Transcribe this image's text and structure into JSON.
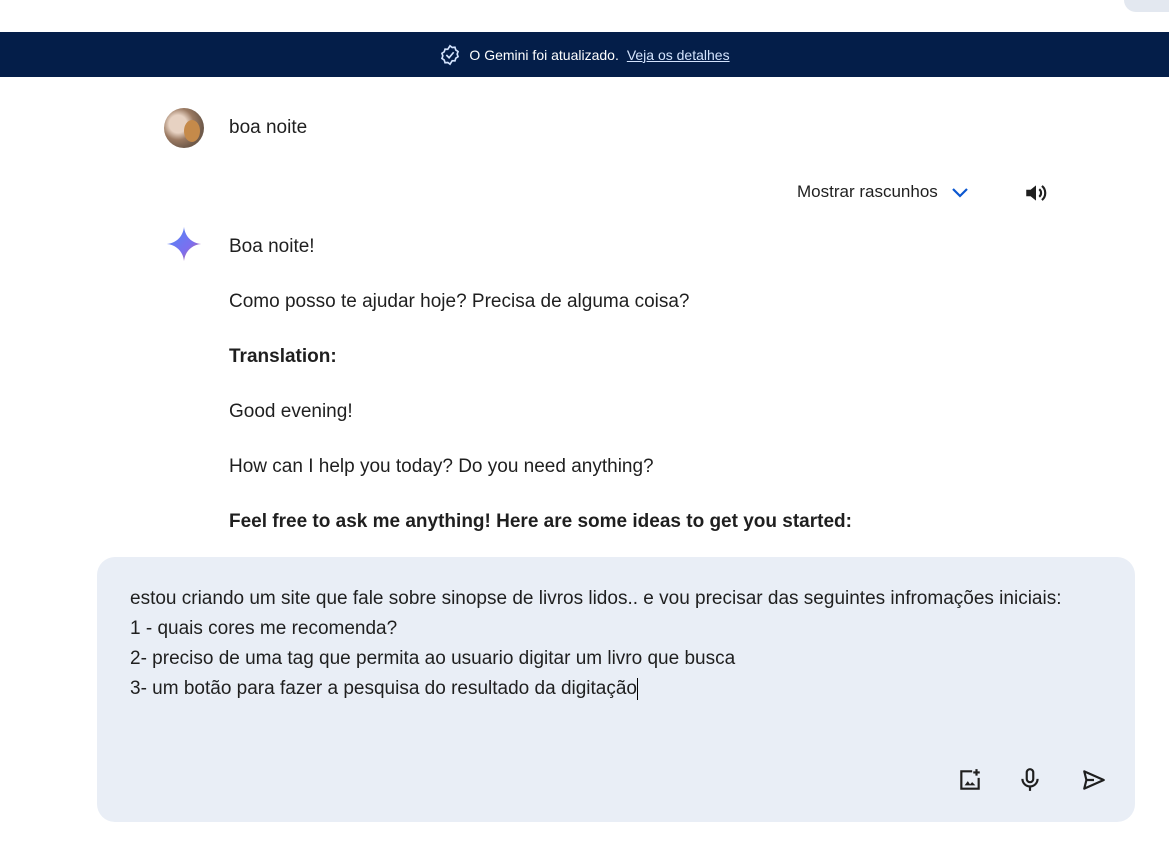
{
  "banner": {
    "text": "O Gemini foi atualizado.",
    "link": "Veja os detalhes"
  },
  "user_message": "boa noite",
  "response_controls": {
    "show_drafts": "Mostrar rascunhos"
  },
  "response": {
    "paragraphs": [
      "Boa noite!",
      "Como posso te ajudar hoje? Precisa de alguma coisa?"
    ],
    "translation_heading": "Translation:",
    "translation": [
      "Good evening!",
      "How can I help you today? Do you need anything?"
    ],
    "ideas_heading": "Feel free to ask me anything! Here are some ideas to get you started:"
  },
  "prompt": {
    "value": "estou criando um site que fale sobre sinopse de livros lidos.. e vou precisar das seguintes infromações iniciais:\n1 - quais cores me recomenda?\n2- preciso de uma tag que permita ao usuario digitar um livro que busca\n3- um botão para fazer a pesquisa do resultado da digitação"
  },
  "colors": {
    "banner": "#041e49",
    "input_bg": "#e9eef6",
    "accent": "#0b57d0"
  }
}
